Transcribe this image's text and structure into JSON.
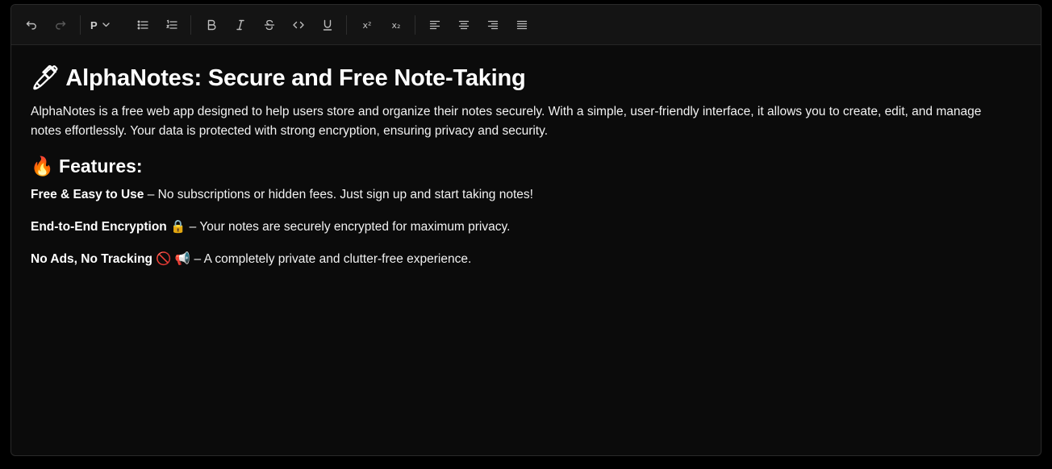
{
  "toolbar": {
    "buttons": {
      "undo": "undo-icon",
      "redo": "redo-icon",
      "bullet_list": "bullet-list-icon",
      "ordered_list": "ordered-list-icon",
      "bold": "bold-icon",
      "italic": "italic-icon",
      "strike": "strikethrough-icon",
      "code": "code-icon",
      "underline": "underline-icon",
      "superscript": "x²",
      "subscript": "x₂",
      "align_left": "align-left-icon",
      "align_center": "align-center-icon",
      "align_right": "align-right-icon",
      "align_justify": "align-justify-icon"
    },
    "block_type": "P"
  },
  "document": {
    "title": "🖊 AlphaNotes: Secure and Free Note-Taking",
    "intro": "AlphaNotes is a free web app designed to help users store and organize their notes securely. With a simple, user-friendly interface, it allows you to create, edit, and manage notes effortlessly. Your data is protected with strong encryption, ensuring privacy and security.",
    "features_heading": "🔥 Features:",
    "features": [
      {
        "title": "Free & Easy to Use",
        "text": " – No subscriptions or hidden fees. Just sign up and start taking notes!"
      },
      {
        "title": "End-to-End Encryption 🔒",
        "text": " – Your notes are securely encrypted for maximum privacy."
      },
      {
        "title": "No Ads, No Tracking 🚫 📢",
        "text": " – A completely private and clutter-free experience."
      }
    ]
  },
  "colors": {
    "background": "#000000",
    "editor_bg": "#0b0b0b",
    "toolbar_bg": "#141414",
    "text": "#ffffff",
    "icon": "#bdbdbd"
  }
}
